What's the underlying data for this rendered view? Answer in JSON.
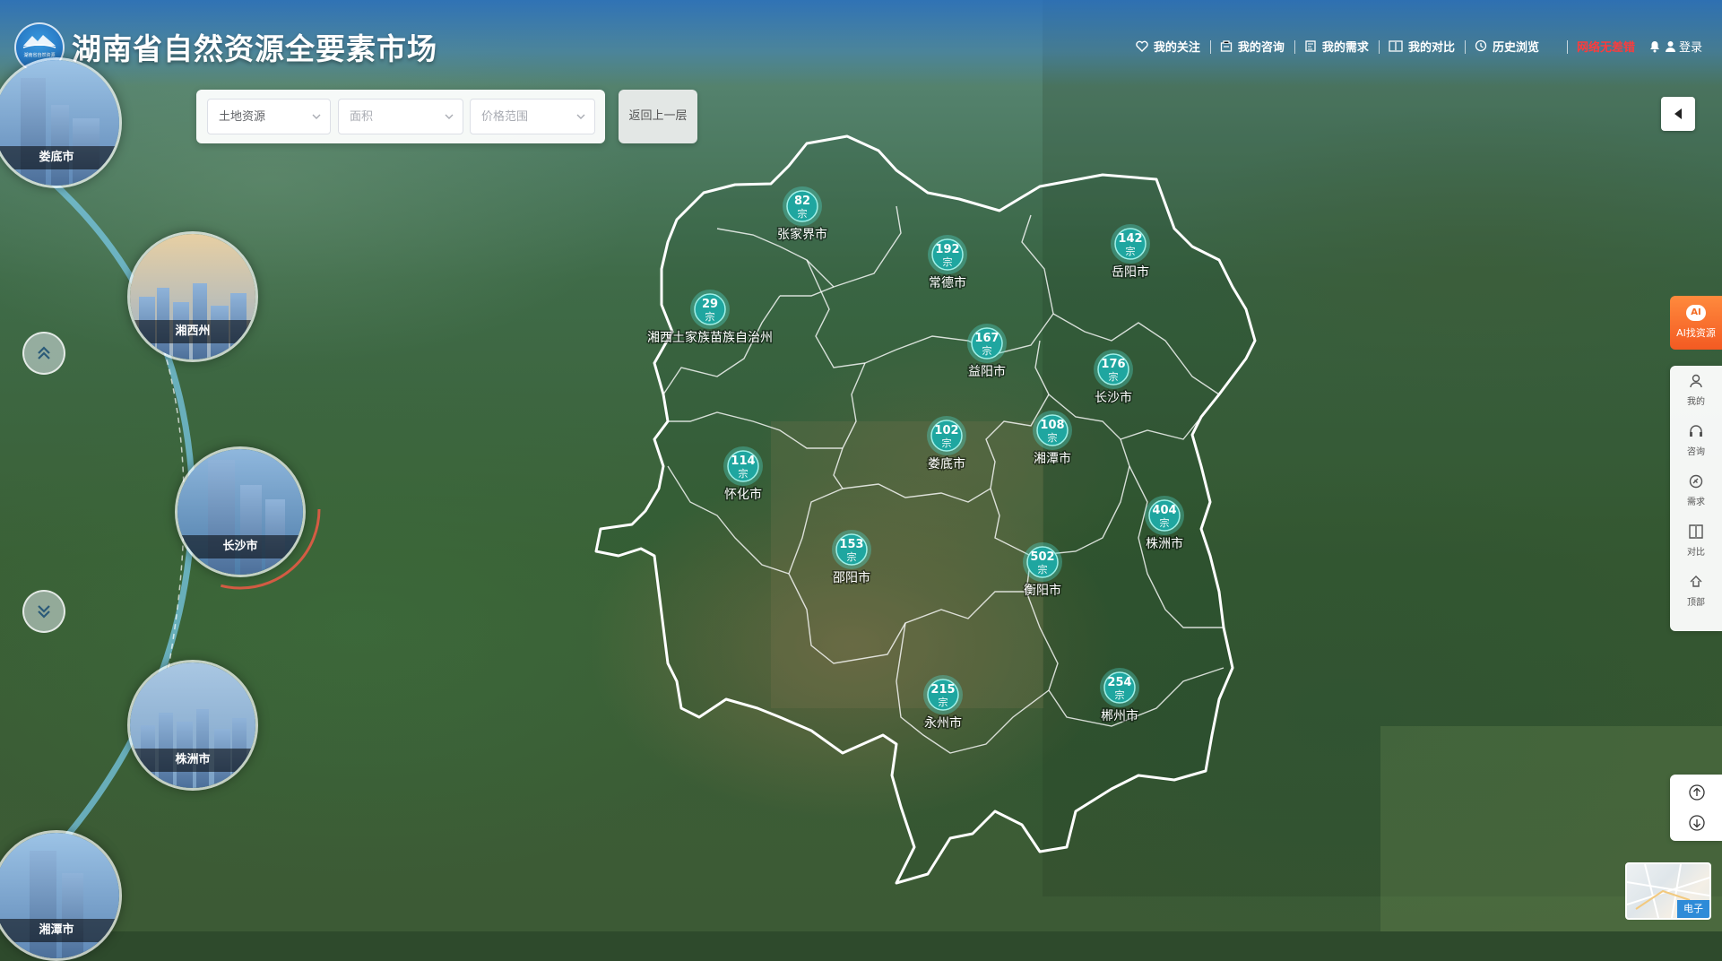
{
  "app": {
    "title": "湖南省自然资源全要素市场",
    "logo_text": "湖南省自然资源"
  },
  "nav": {
    "items": [
      {
        "label": "我的关注",
        "icon": "heart-icon"
      },
      {
        "label": "我的咨询",
        "icon": "consult-icon"
      },
      {
        "label": "我的需求",
        "icon": "demand-icon"
      },
      {
        "label": "我的对比",
        "icon": "compare-icon"
      },
      {
        "label": "历史浏览",
        "icon": "history-icon"
      }
    ],
    "status_text": "网络无差错",
    "status_color": "#ff3b3b",
    "login_label": "登录"
  },
  "filters": {
    "resource_type": "土地资源",
    "area_placeholder": "面积",
    "price_placeholder": "价格范围",
    "back_label": "返回上一层"
  },
  "carousel": {
    "cities": [
      "娄底市",
      "湘西州",
      "长沙市",
      "株洲市",
      "湘潭市"
    ],
    "active_city": "长沙市",
    "up_icon": "double-chevron-up-icon",
    "down_icon": "double-chevron-down-icon"
  },
  "map": {
    "unit": "宗",
    "base_layer_label": "电子",
    "regions": [
      {
        "name": "张家界市",
        "count": "82"
      },
      {
        "name": "常德市",
        "count": "192"
      },
      {
        "name": "岳阳市",
        "count": "142"
      },
      {
        "name": "湘西土家族苗族自治州",
        "count": "29"
      },
      {
        "name": "益阳市",
        "count": "167"
      },
      {
        "name": "长沙市",
        "count": "176"
      },
      {
        "name": "娄底市",
        "count": "102"
      },
      {
        "name": "湘潭市",
        "count": "108"
      },
      {
        "name": "怀化市",
        "count": "114"
      },
      {
        "name": "株洲市",
        "count": "404"
      },
      {
        "name": "邵阳市",
        "count": "153"
      },
      {
        "name": "衡阳市",
        "count": "502"
      },
      {
        "name": "永州市",
        "count": "215"
      },
      {
        "name": "郴州市",
        "count": "254"
      }
    ],
    "marker_color": "#1fa6a0"
  },
  "side_tools": {
    "ai_label": "AI找资源",
    "ai_badge": "AI",
    "items": [
      {
        "label": "我的",
        "icon": "user-icon"
      },
      {
        "label": "咨询",
        "icon": "headset-icon"
      },
      {
        "label": "需求",
        "icon": "link-icon"
      },
      {
        "label": "对比",
        "icon": "compare-icon"
      },
      {
        "label": "顶部",
        "icon": "to-top-icon"
      }
    ]
  }
}
